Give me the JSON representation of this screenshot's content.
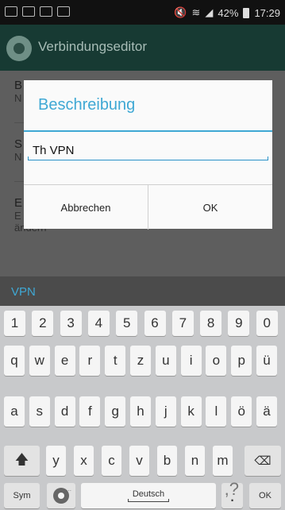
{
  "status_bar": {
    "battery_percent": "42%",
    "time": "17:29",
    "left_icons": [
      "keyboard-icon",
      "image-icon",
      "mail-icon",
      "mail-icon"
    ],
    "right_icons": [
      "mute-icon",
      "wifi-icon",
      "signal-icon",
      "battery-icon"
    ]
  },
  "action_bar": {
    "title": "Verbindungseditor",
    "logo_icon": "app-logo-icon"
  },
  "background_list": {
    "items": [
      {
        "title_fragment": "B",
        "sub_fragment": "N"
      },
      {
        "title_fragment": "S",
        "sub_fragment": "N"
      },
      {
        "title_fragment": "E",
        "sub_fragment": "E",
        "tail_text": "ändern"
      }
    ]
  },
  "dialog": {
    "title": "Beschreibung",
    "input_value": "Th VPN",
    "cancel_label": "Abbrechen",
    "ok_label": "OK"
  },
  "keyboard": {
    "suggestion": "VPN",
    "rows": {
      "numbers": [
        "1",
        "2",
        "3",
        "4",
        "5",
        "6",
        "7",
        "8",
        "9",
        "0"
      ],
      "row1": [
        "q",
        "w",
        "e",
        "r",
        "t",
        "z",
        "u",
        "i",
        "o",
        "p",
        "ü"
      ],
      "row2": [
        "a",
        "s",
        "d",
        "f",
        "g",
        "h",
        "j",
        "k",
        "l",
        "ö",
        "ä"
      ],
      "row3": [
        "y",
        "x",
        "c",
        "v",
        "b",
        "n",
        "m"
      ]
    },
    "sym_label": "Sym",
    "space_label": "Deutsch",
    "period_label": ".",
    "period_hint": ",?",
    "ok_label": "OK",
    "shift_icon": "shift-up-arrow-icon",
    "backspace_icon": "backspace-icon",
    "settings_icon": "gear-icon",
    "settings_hint": "..."
  },
  "colors": {
    "accent": "#3fa8d4",
    "action_bar": "#173a33",
    "keyboard_bg": "#c8c9cb"
  }
}
